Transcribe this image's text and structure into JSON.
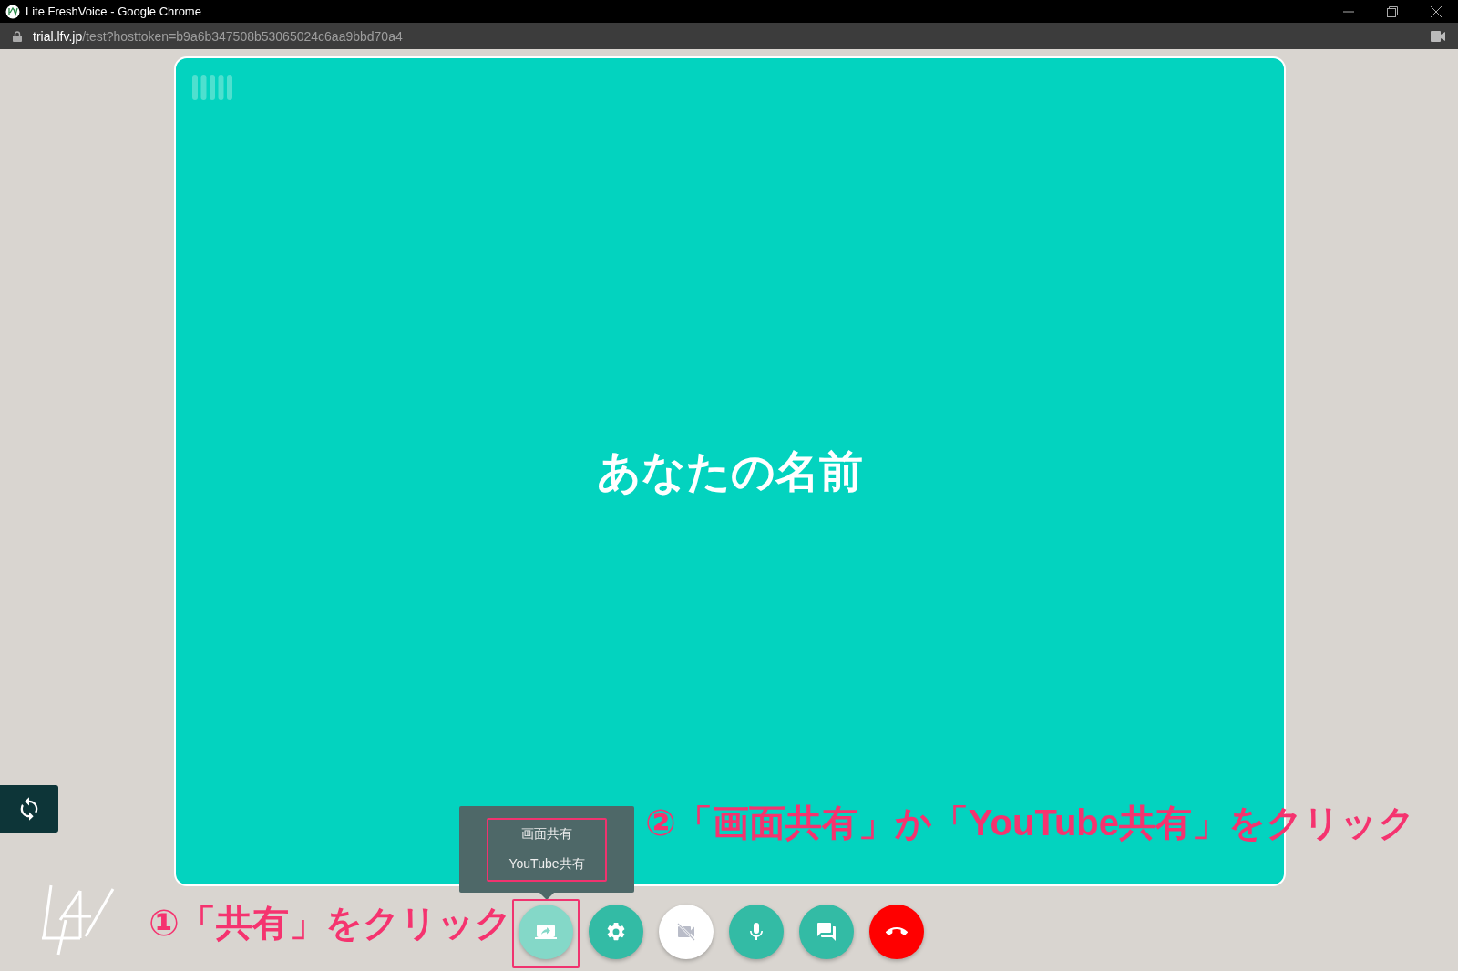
{
  "window": {
    "title": "Lite FreshVoice - Google Chrome"
  },
  "address_bar": {
    "host": "trial.lfv.jp",
    "path": "/test?hosttoken=b9a6b347508b53065024c6aa9bbd70a4"
  },
  "video": {
    "name": "あなたの名前"
  },
  "share_menu": {
    "items": [
      {
        "label": "画面共有"
      },
      {
        "label": "YouTube共有"
      }
    ]
  },
  "controls": [
    {
      "kind": "share",
      "active": true,
      "off": false
    },
    {
      "kind": "settings",
      "active": false,
      "off": false
    },
    {
      "kind": "camera",
      "active": false,
      "off": true
    },
    {
      "kind": "mic",
      "active": false,
      "off": false
    },
    {
      "kind": "chat",
      "active": false,
      "off": false
    },
    {
      "kind": "hangup",
      "active": false,
      "off": false
    }
  ],
  "annotations": [
    {
      "text": "①「共有」をクリック"
    },
    {
      "text": "②「画面共有」か「YouTube共有」をクリック"
    }
  ]
}
